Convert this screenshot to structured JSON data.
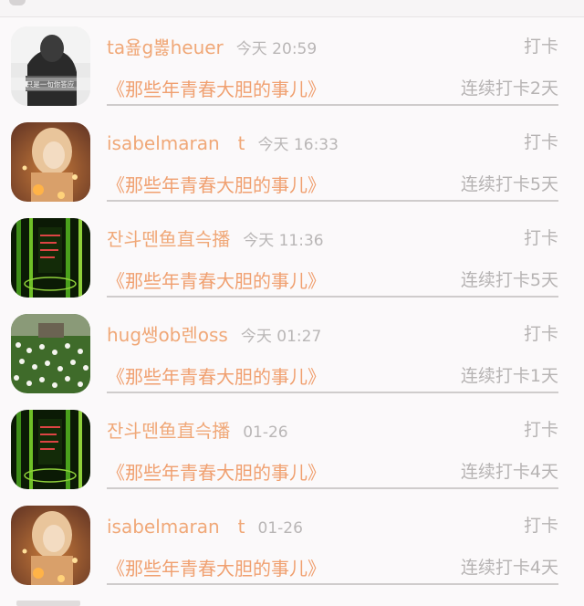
{
  "items": [
    {
      "name": "ta욢g뽏heuer",
      "time": "今天 20:59",
      "action": "打卡",
      "title": "《那些年青春大胆的事儿》",
      "streak": "连续打卡2天",
      "avatar": "photo-man-sweater",
      "avatar_caption": "只是一句你答应"
    },
    {
      "name": "isabelmaran　t",
      "time": "今天 16:33",
      "action": "打卡",
      "title": "《那些年青春大胆的事儿》",
      "streak": "连续打卡5天",
      "avatar": "photo-girl-lights"
    },
    {
      "name": "잔斗뗀鱼直슥播",
      "time": "今天 11:36",
      "action": "打卡",
      "title": "《那些年青春大胆的事儿》",
      "streak": "连续打卡5天",
      "avatar": "photo-green-bamboo"
    },
    {
      "name": "hug쌩ob렌oss",
      "time": "今天 01:27",
      "action": "打卡",
      "title": "《那些年青春大胆的事儿》",
      "streak": "连续打卡1天",
      "avatar": "photo-flower-field"
    },
    {
      "name": "잔斗뗀鱼直슥播",
      "time": "01-26",
      "action": "打卡",
      "title": "《那些年青春大胆的事儿》",
      "streak": "连续打卡4天",
      "avatar": "photo-green-bamboo"
    },
    {
      "name": "isabelmaran　t",
      "time": "01-26",
      "action": "打卡",
      "title": "《那些年青春大胆的事儿》",
      "streak": "连续打卡4天",
      "avatar": "photo-girl-lights"
    }
  ]
}
